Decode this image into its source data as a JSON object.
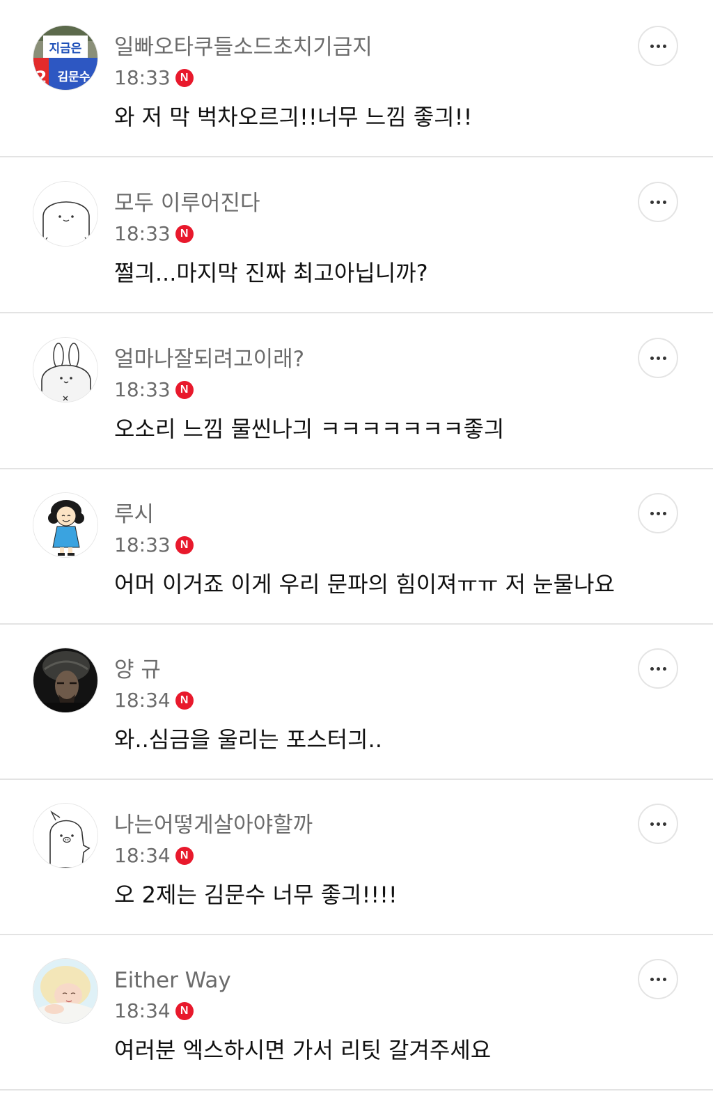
{
  "accent": {
    "badge_color": "#e8192c",
    "name_color": "#6b6b6b",
    "divider_color": "#e3e3e3"
  },
  "comments": [
    {
      "author": "일빠오타쿠들소드초치기금지",
      "time": "18:33",
      "badge": "N",
      "text": "와 저 막 벅차오르긔!!너무 느낌 좋긔!!",
      "avatar": "campaign-poster-avatar",
      "avatar_text": [
        "지금은",
        "2",
        "김문수"
      ]
    },
    {
      "author": "모두 이루어진다",
      "time": "18:33",
      "badge": "N",
      "text": "쩔긔...마지막 진짜 최고아닙니까?",
      "avatar": "blob-character-avatar"
    },
    {
      "author": "얼마나잘되려고이래?",
      "time": "18:33",
      "badge": "N",
      "text": "오소리 느낌 물씬나긔 ㅋㅋㅋㅋㅋㅋㅋ좋긔",
      "avatar": "bunny-character-avatar"
    },
    {
      "author": "루시",
      "time": "18:33",
      "badge": "N",
      "text": "어머 이거죠 이게 우리 문파의 힘이져ㅠㅠ 저 눈물나요",
      "avatar": "cartoon-girl-avatar"
    },
    {
      "author": "양 규",
      "time": "18:34",
      "badge": "N",
      "text": "와..심금을 울리는 포스터긔..",
      "avatar": "warrior-photo-avatar"
    },
    {
      "author": "나는어떻게살아야할까",
      "time": "18:34",
      "badge": "N",
      "text": "오 2제는 김문수 너무 좋긔!!!!",
      "avatar": "pig-ghost-character-avatar"
    },
    {
      "author": "Either Way",
      "time": "18:34",
      "badge": "N",
      "text": "여러분 엑스하시면 가서 리팃 갈겨주세요",
      "avatar": "blonde-person-photo-avatar"
    }
  ]
}
